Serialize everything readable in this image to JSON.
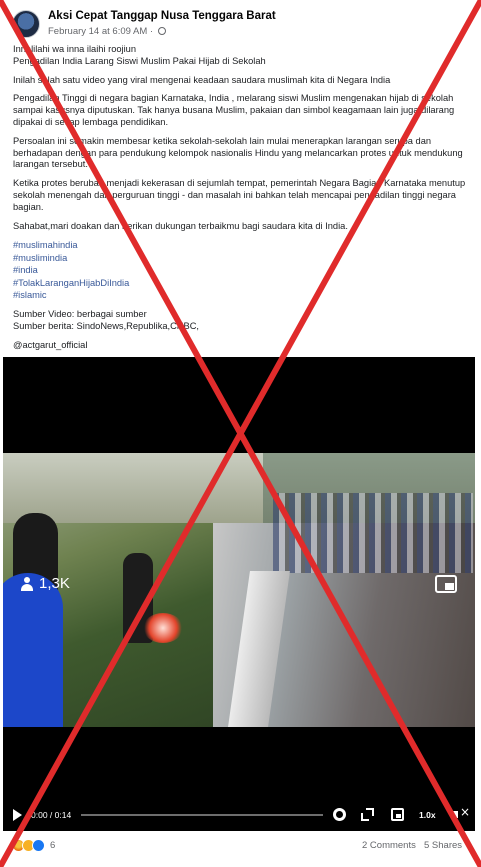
{
  "post": {
    "page_name": "Aksi Cepat Tanggap Nusa Tenggara Barat",
    "timestamp": "February 14 at 6:09 AM",
    "separator": " · ",
    "paragraphs": [
      [
        "Innalilahi wa inna ilaihi roojiun",
        "Pengadilan India Larang Siswi Muslim Pakai Hijab di Sekolah"
      ],
      [
        "Inilah salah satu video yang viral mengenai keadaan saudara muslimah kita di Negara India"
      ],
      [
        "Pengadilan Tinggi di negara bagian Karnataka, India , melarang siswi Muslim mengenakan hijab di sekolah sampai kasusnya diputuskan. Tak hanya busana Muslim, pakaian dan simbol keagamaan lain juga dilarang dipakai di setiap lembaga pendidikan."
      ],
      [
        "Persoalan ini semakin membesar ketika sekolah-sekolah lain mulai menerapkan larangan serupa dan berhadapan dengan para pendukung kelompok nasionalis Hindu yang melancarkan protes untuk mendukung larangan tersebut."
      ],
      [
        "Ketika protes berubah menjadi kekerasan di sejumlah tempat, pemerintah Negara Bagian Karnataka menutup sekolah menengah dan perguruan tinggi - dan masalah ini bahkan telah mencapai pengadilan tinggi negara bagian."
      ],
      [
        "Sahabat,mari doakan dan berikan dukungan terbaikmu bagi saudara kita di India."
      ]
    ],
    "hashtags": [
      "#muslimahindia",
      "#muslimindia",
      "#india",
      "#TolakLaranganHijabDiIndia",
      "#islamic"
    ],
    "source_video": "Sumber Video: berbagai sumber",
    "source_news": "Sumber berita: SindoNews,Republika,CNBC,",
    "handle": "@actgarut_official"
  },
  "video": {
    "view_count": "1,3K",
    "time": "0:00 / 0:14",
    "speed": "1.0x",
    "icons": [
      "person-icon",
      "pip-icon",
      "play-icon",
      "gear-icon",
      "expand-icon",
      "mini-player-icon",
      "mute-icon"
    ]
  },
  "footer": {
    "reaction_count": "6",
    "comments": "2 Comments",
    "shares": "5 Shares",
    "reaction_icons": [
      "angry",
      "sad",
      "like"
    ]
  },
  "overlay": {
    "x_color": "#e02b2b"
  }
}
